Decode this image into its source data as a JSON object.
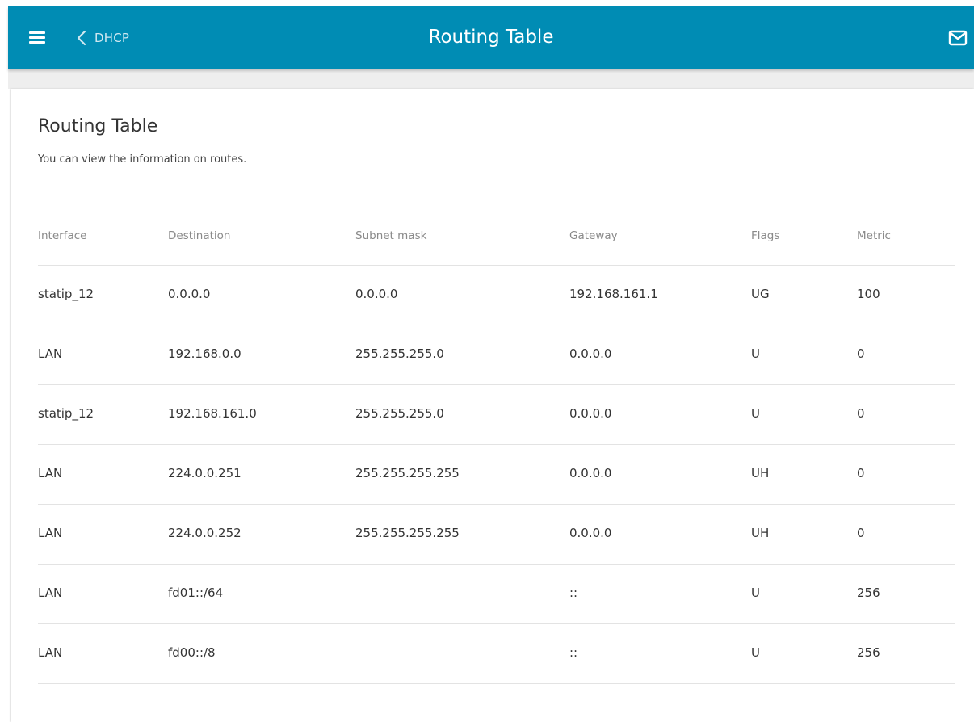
{
  "header": {
    "back_label": "DHCP",
    "title": "Routing Table",
    "menu_icon": "hamburger-menu-icon",
    "back_icon": "chevron-left-icon",
    "mail_icon": "mail-icon",
    "background_color": "#008cb4"
  },
  "page": {
    "title": "Routing Table",
    "description": "You can view the information on routes."
  },
  "table": {
    "columns": [
      "Interface",
      "Destination",
      "Subnet mask",
      "Gateway",
      "Flags",
      "Metric"
    ],
    "rows": [
      {
        "interface": "statip_12",
        "destination": "0.0.0.0",
        "subnet_mask": "0.0.0.0",
        "gateway": "192.168.161.1",
        "flags": "UG",
        "metric": "100"
      },
      {
        "interface": "LAN",
        "destination": "192.168.0.0",
        "subnet_mask": "255.255.255.0",
        "gateway": "0.0.0.0",
        "flags": "U",
        "metric": "0"
      },
      {
        "interface": "statip_12",
        "destination": "192.168.161.0",
        "subnet_mask": "255.255.255.0",
        "gateway": "0.0.0.0",
        "flags": "U",
        "metric": "0"
      },
      {
        "interface": "LAN",
        "destination": "224.0.0.251",
        "subnet_mask": "255.255.255.255",
        "gateway": "0.0.0.0",
        "flags": "UH",
        "metric": "0"
      },
      {
        "interface": "LAN",
        "destination": "224.0.0.252",
        "subnet_mask": "255.255.255.255",
        "gateway": "0.0.0.0",
        "flags": "UH",
        "metric": "0"
      },
      {
        "interface": "LAN",
        "destination": "fd01::/64",
        "subnet_mask": "",
        "gateway": "::",
        "flags": "U",
        "metric": "256"
      },
      {
        "interface": "LAN",
        "destination": "fd00::/8",
        "subnet_mask": "",
        "gateway": "::",
        "flags": "U",
        "metric": "256"
      }
    ]
  }
}
